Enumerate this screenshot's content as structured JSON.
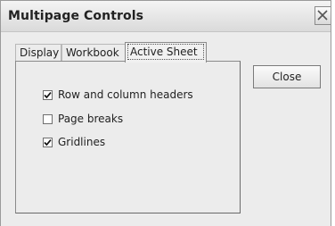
{
  "window": {
    "title": "Multipage Controls",
    "close_icon": "close-x-icon"
  },
  "tabs": [
    {
      "label": "Display",
      "selected": false
    },
    {
      "label": "Workbook",
      "selected": false
    },
    {
      "label": "Active Sheet",
      "selected": true
    }
  ],
  "options": [
    {
      "label": "Row and column headers",
      "checked": true
    },
    {
      "label": "Page breaks",
      "checked": false
    },
    {
      "label": "Gridlines",
      "checked": true
    }
  ],
  "buttons": {
    "close_label": "Close"
  }
}
